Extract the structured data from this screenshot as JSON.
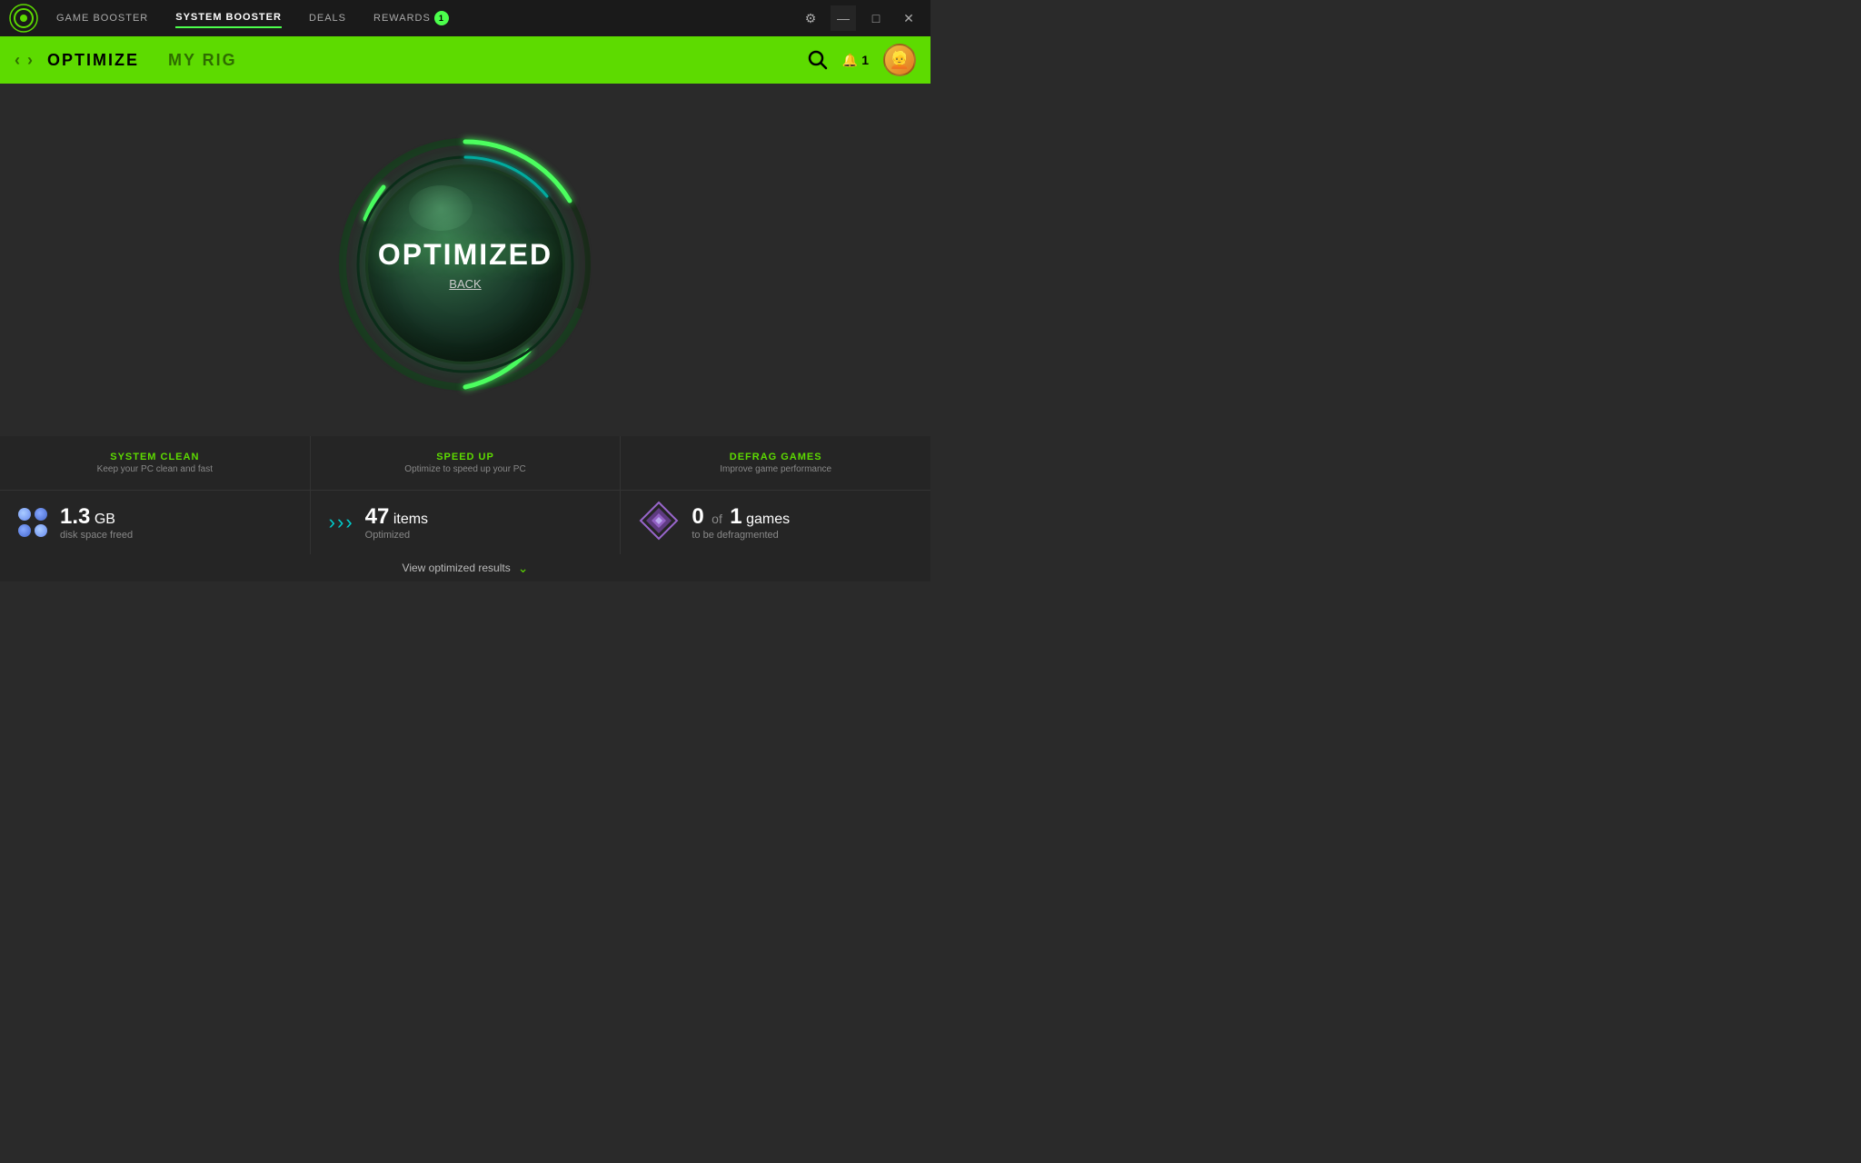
{
  "titlebar": {
    "nav": [
      {
        "id": "game-booster",
        "label": "GAME BOOSTER",
        "active": false
      },
      {
        "id": "system-booster",
        "label": "SYSTEM BOOSTER",
        "active": true
      },
      {
        "id": "deals",
        "label": "DEALS",
        "active": false
      },
      {
        "id": "rewards",
        "label": "REWARDS",
        "active": false,
        "badge": "1"
      }
    ],
    "settings_icon": "⚙",
    "minimize_icon": "—",
    "maximize_icon": "□",
    "close_icon": "✕"
  },
  "subheader": {
    "back_arrow": "‹",
    "forward_arrow": "›",
    "tabs": [
      {
        "id": "optimize",
        "label": "OPTIMIZE",
        "active": true
      },
      {
        "id": "my-rig",
        "label": "MY RIG",
        "active": false
      }
    ],
    "search_icon": "🔍",
    "notification_count": "1",
    "avatar_emoji": "👱"
  },
  "main": {
    "status_text": "OPTIMIZED",
    "back_link": "BACK"
  },
  "stats": {
    "cards": [
      {
        "id": "system-clean",
        "title": "SYSTEM CLEAN",
        "description": "Keep your PC clean and fast"
      },
      {
        "id": "speed-up",
        "title": "SPEED UP",
        "description": "Optimize to speed up your PC"
      },
      {
        "id": "defrag-games",
        "title": "DEFRAG GAMES",
        "description": "Improve game performance"
      }
    ],
    "values": [
      {
        "id": "disk-freed",
        "number": "1.3",
        "unit": "GB",
        "sublabel": "disk space freed"
      },
      {
        "id": "items-optimized",
        "number": "47",
        "unit": "items",
        "sublabel": "Optimized"
      },
      {
        "id": "games-defrag",
        "number": "0",
        "of_label": "of",
        "total": "1",
        "unit": "games",
        "sublabel": "to be defragmented"
      }
    ],
    "view_results_label": "View optimized results",
    "view_results_icon": "⌄"
  },
  "colors": {
    "accent": "#5ddb00",
    "background": "#2a2a2a",
    "card_bg": "#252525",
    "ring_color": "#3ddd44"
  }
}
